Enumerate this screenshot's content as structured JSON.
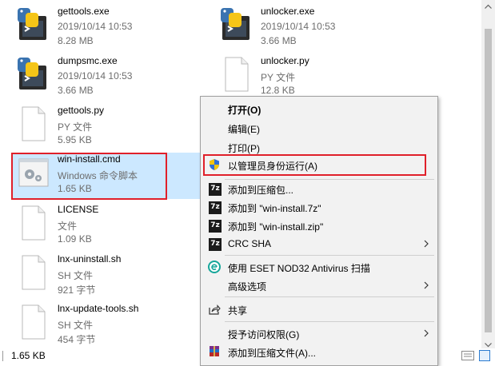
{
  "files": [
    {
      "name": "gettools.exe",
      "line2": "2019/10/14 10:53",
      "line3": "8.28 MB",
      "icon": "python-exe-icon"
    },
    {
      "name": "unlocker.exe",
      "line2": "2019/10/14 10:53",
      "line3": "3.66 MB",
      "icon": "python-exe-icon"
    },
    {
      "name": "dumpsmc.exe",
      "line2": "2019/10/14 10:53",
      "line3": "3.66 MB",
      "icon": "python-exe-icon"
    },
    {
      "name": "unlocker.py",
      "line2": "PY 文件",
      "line3": "12.8 KB",
      "icon": "blank-file-icon"
    },
    {
      "name": "gettools.py",
      "line2": "PY 文件",
      "line3": "5.95 KB",
      "icon": "blank-file-icon"
    },
    {
      "name": "win-install.cmd",
      "line2": "Windows 命令脚本",
      "line3": "1.65 KB",
      "icon": "gear-file-icon"
    },
    {
      "name": "LICENSE",
      "line2": "文件",
      "line3": "1.09 KB",
      "icon": "blank-file-icon"
    },
    {
      "name": "lnx-uninstall.sh",
      "line2": "SH 文件",
      "line3": "921 字节",
      "icon": "blank-file-icon"
    },
    {
      "name": "lnx-update-tools.sh",
      "line2": "SH 文件",
      "line3": "454 字节",
      "icon": "blank-file-icon"
    }
  ],
  "status_bar": {
    "selection_size": "1.65 KB"
  },
  "context_menu": {
    "open": "打开(O)",
    "edit": "编辑(E)",
    "print": "打印(P)",
    "run_as_admin": "以管理员身份运行(A)",
    "add_to_archive": "添加到压缩包...",
    "add_to_7z": "添加到 \"win-install.7z\"",
    "add_to_zip": "添加到 \"win-install.zip\"",
    "crc_sha": "CRC SHA",
    "eset_scan": "使用 ESET NOD32 Antivirus 扫描",
    "advanced": "高级选项",
    "share": "共享",
    "grant_access": "授予访问权限(G)",
    "add_to_rar": "添加到压缩文件(A)..."
  },
  "colors": {
    "highlight_box": "#e0202a",
    "selection_bg": "#cce8ff",
    "menu_bg": "#f2f2f2"
  }
}
